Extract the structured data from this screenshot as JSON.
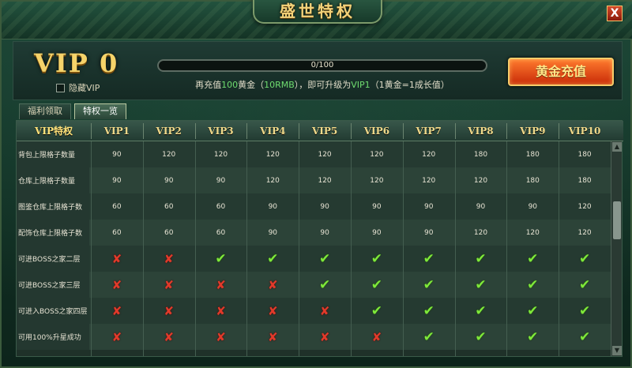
{
  "window": {
    "title": "盛世特权",
    "close_label": "X"
  },
  "header": {
    "vip_level": "VIP 0",
    "hide_vip_label": "隐藏VIP",
    "hide_vip_checked": false,
    "progress_text": "0/100",
    "progress_fraction": 0.0,
    "hint_prefix": "再充值",
    "hint_amount": "100",
    "hint_middle": "黄金（",
    "hint_rmb": "10RMB",
    "hint_middle2": "），即可升级为",
    "hint_target": "VIP1",
    "hint_suffix": "（1黄金=1成长值）",
    "recharge_button": "黄金充值"
  },
  "tabs": [
    {
      "label": "福利领取",
      "active": false
    },
    {
      "label": "特权一览",
      "active": true
    }
  ],
  "table": {
    "corner": "VIP特权",
    "columns": [
      "VIP1",
      "VIP2",
      "VIP3",
      "VIP4",
      "VIP5",
      "VIP6",
      "VIP7",
      "VIP8",
      "VIP9",
      "VIP10"
    ],
    "rows": [
      {
        "label": "背包上限格子数量",
        "values": [
          "90",
          "120",
          "120",
          "120",
          "120",
          "120",
          "120",
          "180",
          "180",
          "180"
        ]
      },
      {
        "label": "仓库上限格子数量",
        "values": [
          "90",
          "90",
          "90",
          "120",
          "120",
          "120",
          "120",
          "120",
          "180",
          "180"
        ]
      },
      {
        "label": "图鉴仓库上限格子数",
        "values": [
          "60",
          "60",
          "60",
          "90",
          "90",
          "90",
          "90",
          "90",
          "90",
          "120"
        ]
      },
      {
        "label": "配饰仓库上限格子数",
        "values": [
          "60",
          "60",
          "60",
          "90",
          "90",
          "90",
          "90",
          "120",
          "120",
          "120"
        ]
      },
      {
        "label": "可进BOSS之家二层",
        "values": [
          "✘",
          "✘",
          "✔",
          "✔",
          "✔",
          "✔",
          "✔",
          "✔",
          "✔",
          "✔"
        ]
      },
      {
        "label": "可进BOSS之家三层",
        "values": [
          "✘",
          "✘",
          "✘",
          "✘",
          "✔",
          "✔",
          "✔",
          "✔",
          "✔",
          "✔"
        ]
      },
      {
        "label": "可进入BOSS之家四层",
        "values": [
          "✘",
          "✘",
          "✘",
          "✘",
          "✘",
          "✔",
          "✔",
          "✔",
          "✔",
          "✔"
        ]
      },
      {
        "label": "可用100%升星成功",
        "values": [
          "✘",
          "✘",
          "✘",
          "✘",
          "✘",
          "✘",
          "✔",
          "✔",
          "✔",
          "✔"
        ]
      }
    ]
  },
  "colors": {
    "tick": "#7ee83a",
    "cross": "#e23a2a",
    "gold": "#f0d98a",
    "button": "#c82a08"
  },
  "icons": {
    "yes": "check-icon",
    "no": "cross-icon",
    "scroll_up": "arrow-up-icon",
    "scroll_down": "arrow-down-icon"
  }
}
